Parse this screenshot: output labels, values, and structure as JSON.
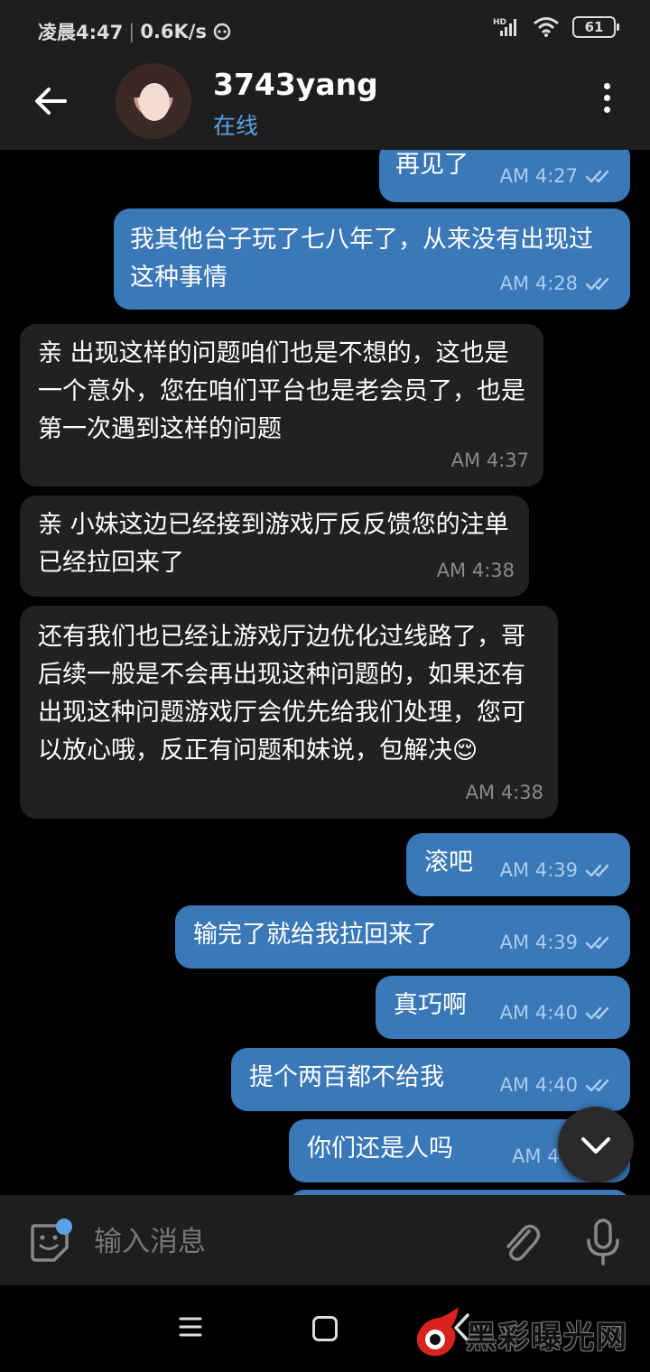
{
  "status_bar": {
    "time": "凌晨4:47",
    "speed": "0.6K/s",
    "network": "HD",
    "battery": "61"
  },
  "header": {
    "contact_name": "3743yang",
    "contact_status": "在线"
  },
  "colors": {
    "outgoing_bubble": "#3a78b8",
    "incoming_bubble": "#212121",
    "accent": "#5aa2e6",
    "bar_background": "#1e1e1e"
  },
  "messages": [
    {
      "direction": "out",
      "text": "再见了",
      "time": "AM 4:27",
      "read": true
    },
    {
      "direction": "out",
      "text": "我其他台子玩了七八年了，从来没有出现过这种事情",
      "time": "AM 4:28",
      "read": true
    },
    {
      "direction": "in",
      "text": "亲 出现这样的问题咱们也是不想的，这也是一个意外，您在咱们平台也是老会员了，也是第一次遇到这样的问题",
      "time": "AM 4:37"
    },
    {
      "direction": "in",
      "text": "亲  小妹这边已经接到游戏厅反反馈您的注单已经拉回来了",
      "time": "AM 4:38"
    },
    {
      "direction": "in",
      "text": "还有我们也已经让游戏厅边优化过线路了，哥 后续一般是不会再出现这种问题的，如果还有出现这种问题游戏厅会优先给我们处理，您可以放心哦，反正有问题和妹说，包解决😌",
      "time": "AM 4:38"
    },
    {
      "direction": "out",
      "text": "滚吧",
      "time": "AM 4:39",
      "read": true
    },
    {
      "direction": "out",
      "text": "输完了就给我拉回来了",
      "time": "AM 4:39",
      "read": true
    },
    {
      "direction": "out",
      "text": "真巧啊",
      "time": "AM 4:40",
      "read": true
    },
    {
      "direction": "out",
      "text": "提个两百都不给我",
      "time": "AM 4:40",
      "read": true
    },
    {
      "direction": "out",
      "text": "你们还是人吗",
      "time": "AM 4:4",
      "read": true
    }
  ],
  "input": {
    "placeholder": "输入消息"
  },
  "icons": {
    "back": "arrow-left-icon",
    "menu": "more-vert-icon",
    "scroll": "chevron-down-icon",
    "emoji": "sticker-icon",
    "attach": "paperclip-icon",
    "mic": "microphone-icon"
  },
  "watermark": {
    "text": "黑彩曝光网"
  }
}
